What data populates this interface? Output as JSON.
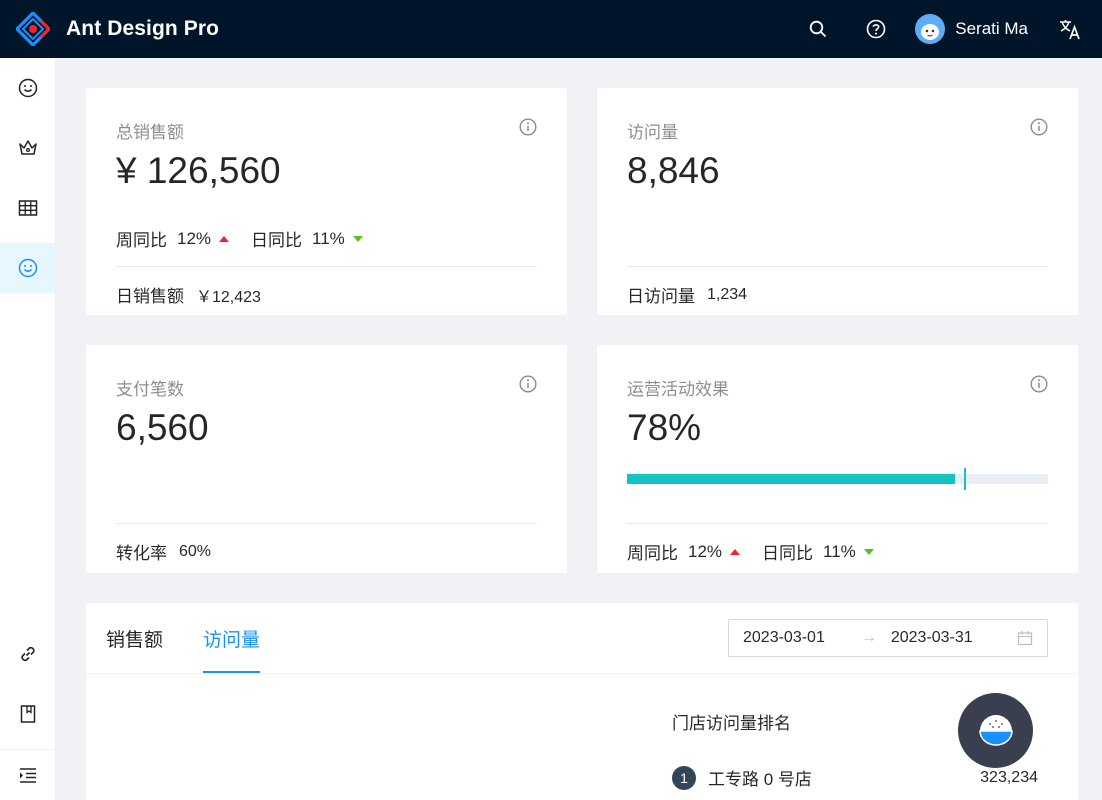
{
  "header": {
    "title": "Ant Design Pro",
    "username": "Serati Ma"
  },
  "cards": {
    "sales": {
      "title": "总销售额",
      "value": "¥ 126,560",
      "week_label": "周同比",
      "week_value": "12%",
      "day_label": "日同比",
      "day_value": "11%",
      "footer_label": "日销售额",
      "footer_value": "￥12,423"
    },
    "visits": {
      "title": "访问量",
      "value": "8,846",
      "footer_label": "日访问量",
      "footer_value": "1,234"
    },
    "payments": {
      "title": "支付笔数",
      "value": "6,560",
      "footer_label": "转化率",
      "footer_value": "60%"
    },
    "operations": {
      "title": "运营活动效果",
      "value": "78%",
      "progress_fraction": 0.78,
      "target_fraction": 0.8,
      "week_label": "周同比",
      "week_value": "12%",
      "day_label": "日同比",
      "day_value": "11%"
    }
  },
  "panel": {
    "tabs": [
      {
        "label": "销售额"
      },
      {
        "label": "访问量"
      }
    ],
    "date_start": "2023-03-01",
    "date_end": "2023-03-31",
    "date_arrow": "→",
    "rank_title": "门店访问量排名",
    "rank": [
      {
        "num": "1",
        "name": "工专路 0 号店",
        "value": "323,234"
      }
    ]
  },
  "colors": {
    "header_bg": "#001529",
    "primary": "#1890ff",
    "progress": "#13c2c2",
    "trend_up": "#f5222d",
    "trend_down": "#52c41a"
  }
}
